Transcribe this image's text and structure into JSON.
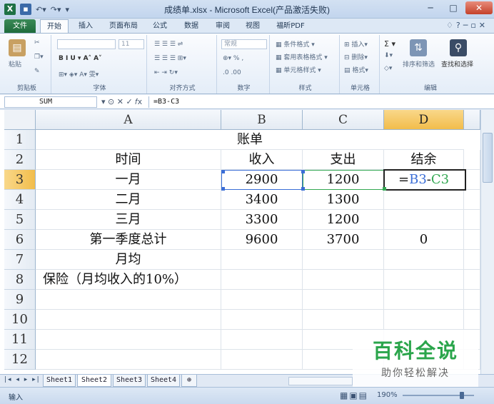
{
  "window": {
    "title": "成绩单.xlsx - Microsoft Excel(产品激活失败)",
    "minimize": "─",
    "maximize": "□",
    "close": "✕"
  },
  "ribbon": {
    "tabs": [
      "文件",
      "开始",
      "插入",
      "页面布局",
      "公式",
      "数据",
      "审阅",
      "视图",
      "福昕PDF"
    ],
    "active_tab": "开始",
    "groups": {
      "clipboard": {
        "label": "剪贴板",
        "paste": "粘贴"
      },
      "font": {
        "label": "字体",
        "size": "11"
      },
      "alignment": {
        "label": "对齐方式"
      },
      "number": {
        "label": "数字",
        "format": "常规"
      },
      "styles": {
        "label": "样式",
        "conditional": "条件格式",
        "table": "套用表格格式",
        "cell_styles": "单元格样式"
      },
      "cells": {
        "label": "单元格",
        "insert": "插入",
        "delete": "删除",
        "format": "格式"
      },
      "editing": {
        "label": "编辑",
        "sort": "排序和筛选",
        "find": "查找和选择"
      }
    }
  },
  "formula_bar": {
    "name_box": "SUM",
    "formula": "=B3-C3"
  },
  "sheet": {
    "columns": [
      "A",
      "B",
      "C",
      "D"
    ],
    "selected_column": "D",
    "rows": [
      "1",
      "2",
      "3",
      "4",
      "5",
      "6",
      "7",
      "8",
      "9",
      "10",
      "11",
      "12"
    ],
    "selected_row": "3",
    "title_cell": "账单",
    "headers": {
      "a2": "时间",
      "b2": "收入",
      "c2": "支出",
      "d2": "结余"
    },
    "data": [
      {
        "a": "一月",
        "b": "2900",
        "c": "1200",
        "d": ""
      },
      {
        "a": "二月",
        "b": "3400",
        "c": "1300",
        "d": ""
      },
      {
        "a": "三月",
        "b": "3300",
        "c": "1200",
        "d": ""
      },
      {
        "a": "第一季度总计",
        "b": "9600",
        "c": "3700",
        "d": "0"
      },
      {
        "a": "月均",
        "b": "",
        "c": "",
        "d": ""
      },
      {
        "a": "保险（月均收入的10%）",
        "b": "",
        "c": "",
        "d": ""
      }
    ],
    "editing": {
      "prefix": "=",
      "ref1": "B3",
      "op": "-",
      "ref2": "C3"
    }
  },
  "sheet_tabs": [
    "Sheet1",
    "Sheet2",
    "Sheet3",
    "Sheet4"
  ],
  "active_sheet": "Sheet2",
  "status": {
    "mode": "输入",
    "zoom": "190%"
  },
  "watermark": {
    "title": "百科全说",
    "subtitle": "助你轻松解决"
  },
  "colors": {
    "ref1": "#3b6ed6",
    "ref2": "#34a853",
    "header_selected": "#f2bd4b",
    "file_tab": "#1f6b3c"
  }
}
